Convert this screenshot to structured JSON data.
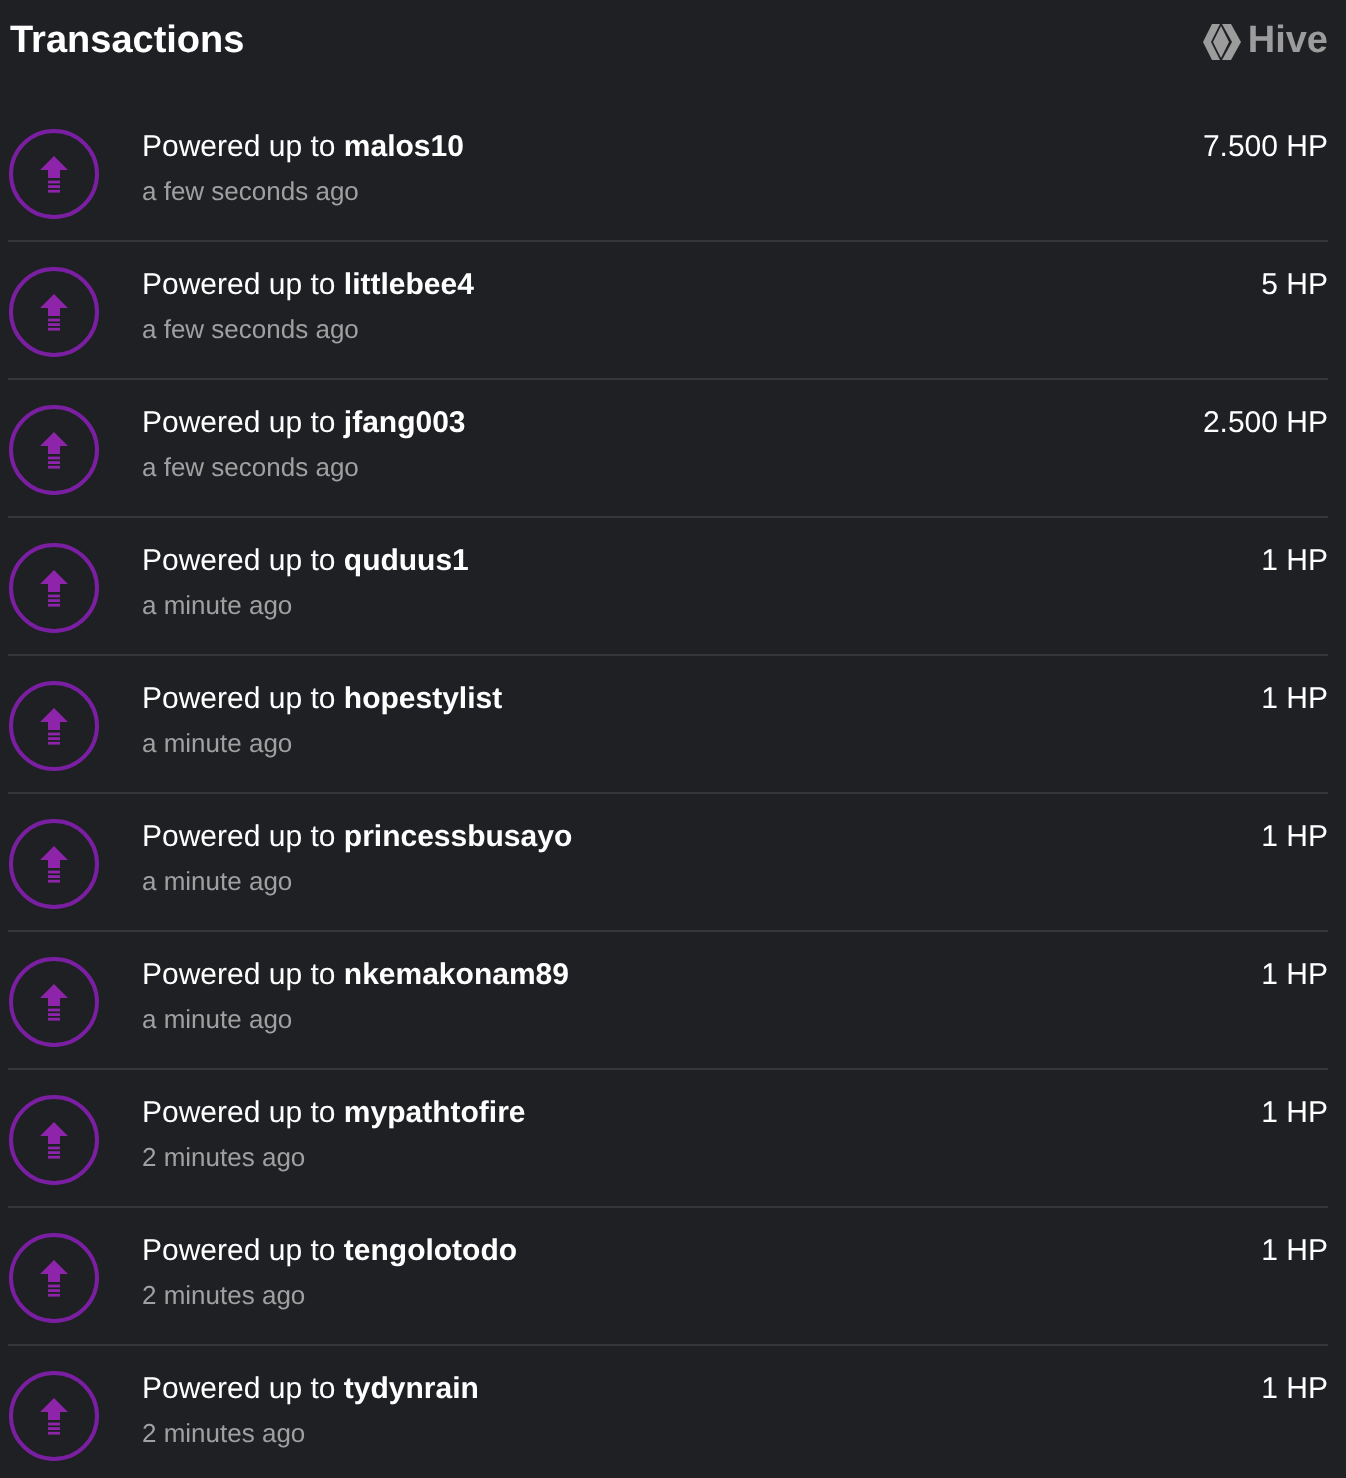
{
  "header": {
    "title": "Transactions",
    "brand": "Hive"
  },
  "transactions": [
    {
      "title": "Powered up to **malos10**",
      "time": "a few seconds ago",
      "amount": "7.500 HP"
    },
    {
      "title": "Powered up to **littlebee4**",
      "time": "a few seconds ago",
      "amount": "5 HP"
    },
    {
      "title": "Powered up to **jfang003**",
      "time": "a few seconds ago",
      "amount": "2.500 HP"
    },
    {
      "title": "Powered up to **quduus1**",
      "time": "a minute ago",
      "amount": "1 HP"
    },
    {
      "title": "Powered up to **hopestylist**",
      "time": "a minute ago",
      "amount": "1 HP"
    },
    {
      "title": "Powered up to **princessbusayo**",
      "time": "a minute ago",
      "amount": "1 HP"
    },
    {
      "title": "Powered up to **nkemakonam89**",
      "time": "a minute ago",
      "amount": "1 HP"
    },
    {
      "title": "Powered up to **mypathtofire**",
      "time": "2 minutes ago",
      "amount": "1 HP"
    },
    {
      "title": "Powered up to **tengolotodo**",
      "time": "2 minutes ago",
      "amount": "1 HP"
    },
    {
      "title": "Powered up to **tydynrain**",
      "time": "2 minutes ago",
      "amount": "1 HP"
    }
  ]
}
